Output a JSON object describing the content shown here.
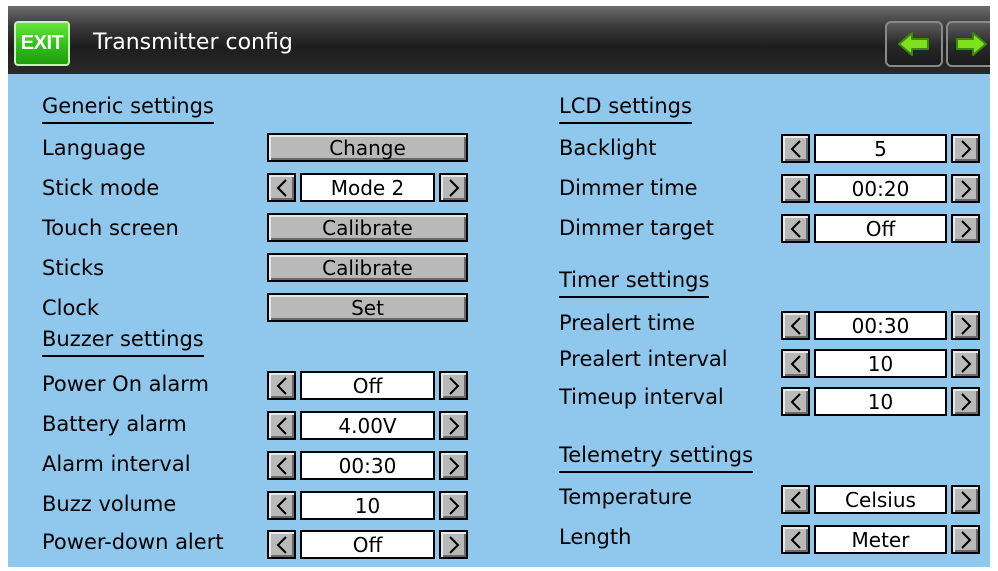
{
  "header": {
    "exit_label": "EXIT",
    "title": "Transmitter config",
    "prev_icon": "arrow-left-icon",
    "next_icon": "arrow-right-icon"
  },
  "colors": {
    "background": "#8fc8ec",
    "exit_green": "#2ec016",
    "arrow_green": "#7ee01e"
  },
  "generic": {
    "heading": "Generic settings",
    "language": {
      "label": "Language",
      "button": "Change"
    },
    "stick_mode": {
      "label": "Stick mode",
      "value": "Mode 2"
    },
    "touch_screen": {
      "label": "Touch screen",
      "button": "Calibrate"
    },
    "sticks": {
      "label": "Sticks",
      "button": "Calibrate"
    },
    "clock": {
      "label": "Clock",
      "button": "Set"
    }
  },
  "buzzer": {
    "heading": "Buzzer settings",
    "power_on_alarm": {
      "label": "Power On alarm",
      "value": "Off"
    },
    "battery_alarm": {
      "label": "Battery alarm",
      "value": "4.00V"
    },
    "alarm_interval": {
      "label": "Alarm interval",
      "value": "00:30"
    },
    "buzz_volume": {
      "label": "Buzz volume",
      "value": "10"
    },
    "power_down_alert": {
      "label": "Power-down alert",
      "value": "Off"
    }
  },
  "lcd": {
    "heading": "LCD settings",
    "backlight": {
      "label": "Backlight",
      "value": "5"
    },
    "dimmer_time": {
      "label": "Dimmer time",
      "value": "00:20"
    },
    "dimmer_target": {
      "label": "Dimmer target",
      "value": "Off"
    }
  },
  "timer": {
    "heading": "Timer settings",
    "prealert_time": {
      "label": "Prealert time",
      "value": "00:30"
    },
    "prealert_interval": {
      "label": "Prealert interval",
      "value": "10"
    },
    "timeup_interval": {
      "label": "Timeup interval",
      "value": "10"
    }
  },
  "telemetry": {
    "heading": "Telemetry settings",
    "temperature": {
      "label": "Temperature",
      "value": "Celsius"
    },
    "length": {
      "label": "Length",
      "value": "Meter"
    }
  }
}
